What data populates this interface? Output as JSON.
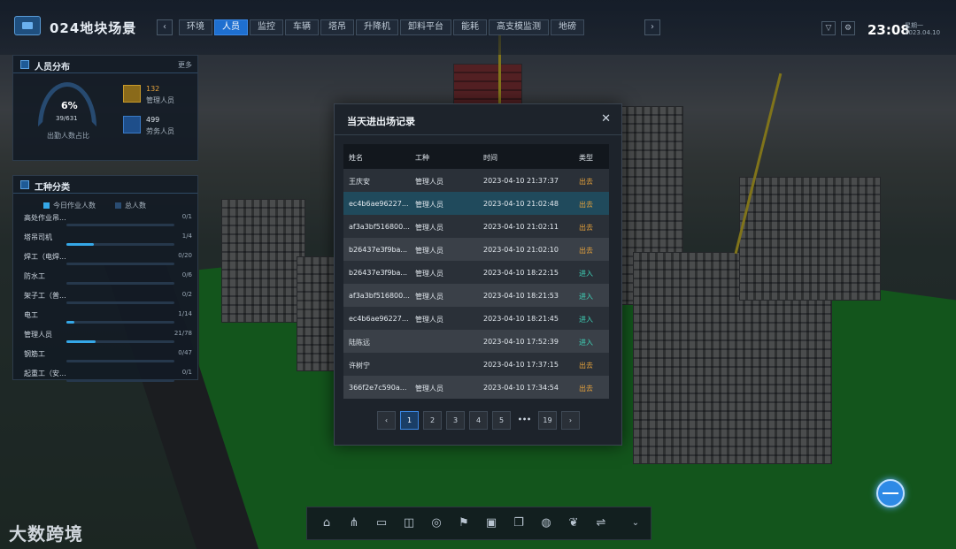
{
  "header": {
    "app_title": "024地块场景",
    "tabs": [
      "环境",
      "人员",
      "监控",
      "车辆",
      "塔吊",
      "升降机",
      "卸料平台",
      "能耗",
      "高支模监测",
      "地磅"
    ],
    "active_tab": "人员",
    "time": "23:08",
    "weekday": "星期一",
    "date": "2023.04.10"
  },
  "personnel_panel": {
    "title": "人员分布",
    "more": "更多",
    "percent": "6%",
    "fraction": "39/631",
    "caption": "出勤人数占比",
    "managers_value": "132",
    "managers_label": "管理人员",
    "workers_value": "499",
    "workers_label": "劳务人员"
  },
  "jobs_panel": {
    "title": "工种分类",
    "legend_today": "今日作业人数",
    "legend_total": "总人数",
    "rows": [
      {
        "name": "高处作业吊...",
        "count": "0/1",
        "ratio": 0
      },
      {
        "name": "塔吊司机",
        "count": "1/4",
        "ratio": 0.25
      },
      {
        "name": "焊工（电焊...",
        "count": "0/20",
        "ratio": 0
      },
      {
        "name": "防水工",
        "count": "0/6",
        "ratio": 0
      },
      {
        "name": "架子工（普...",
        "count": "0/2",
        "ratio": 0
      },
      {
        "name": "电工",
        "count": "1/14",
        "ratio": 0.07
      },
      {
        "name": "管理人员",
        "count": "21/78",
        "ratio": 0.27
      },
      {
        "name": "钢筋工",
        "count": "0/47",
        "ratio": 0
      },
      {
        "name": "起重工（安...",
        "count": "0/1",
        "ratio": 0
      }
    ],
    "colors": {
      "today": "#35a8e8",
      "total": "#2a4c72"
    }
  },
  "modal": {
    "title": "当天进出场记录",
    "columns": [
      "姓名",
      "工种",
      "时间",
      "类型"
    ],
    "rows": [
      {
        "name": "王庆安",
        "job": "管理人员",
        "time": "2023-04-10 21:37:37",
        "type": "出去",
        "kind": "out"
      },
      {
        "name": "ec4b6ae96227...",
        "job": "管理人员",
        "time": "2023-04-10 21:02:48",
        "type": "出去",
        "kind": "out"
      },
      {
        "name": "af3a3bf516800...",
        "job": "管理人员",
        "time": "2023-04-10 21:02:11",
        "type": "出去",
        "kind": "out"
      },
      {
        "name": "b26437e3f9ba...",
        "job": "管理人员",
        "time": "2023-04-10 21:02:10",
        "type": "出去",
        "kind": "out"
      },
      {
        "name": "b26437e3f9ba...",
        "job": "管理人员",
        "time": "2023-04-10 18:22:15",
        "type": "进入",
        "kind": "in"
      },
      {
        "name": "af3a3bf516800...",
        "job": "管理人员",
        "time": "2023-04-10 18:21:53",
        "type": "进入",
        "kind": "in"
      },
      {
        "name": "ec4b6ae96227...",
        "job": "管理人员",
        "time": "2023-04-10 18:21:45",
        "type": "进入",
        "kind": "in"
      },
      {
        "name": "陆陈远",
        "job": "",
        "time": "2023-04-10 17:52:39",
        "type": "进入",
        "kind": "in"
      },
      {
        "name": "许树宁",
        "job": "",
        "time": "2023-04-10 17:37:15",
        "type": "出去",
        "kind": "out"
      },
      {
        "name": "366f2e7c590a...",
        "job": "管理人员",
        "time": "2023-04-10 17:34:54",
        "type": "出去",
        "kind": "out"
      }
    ],
    "pagination": {
      "prev": "‹",
      "pages": [
        "1",
        "2",
        "3",
        "4",
        "5"
      ],
      "ellipsis": "•••",
      "last": "19",
      "next": "›",
      "current": "1"
    }
  },
  "toolbar": {
    "icons": [
      "home-icon",
      "org-tree-icon",
      "panel-icon",
      "book-icon",
      "location-pin-icon",
      "flag-icon",
      "photo-edit-icon",
      "copy-icon",
      "globe-icon",
      "leaf-icon",
      "settings-slider-icon",
      "collapse-icon"
    ]
  },
  "watermark": "大数跨境"
}
